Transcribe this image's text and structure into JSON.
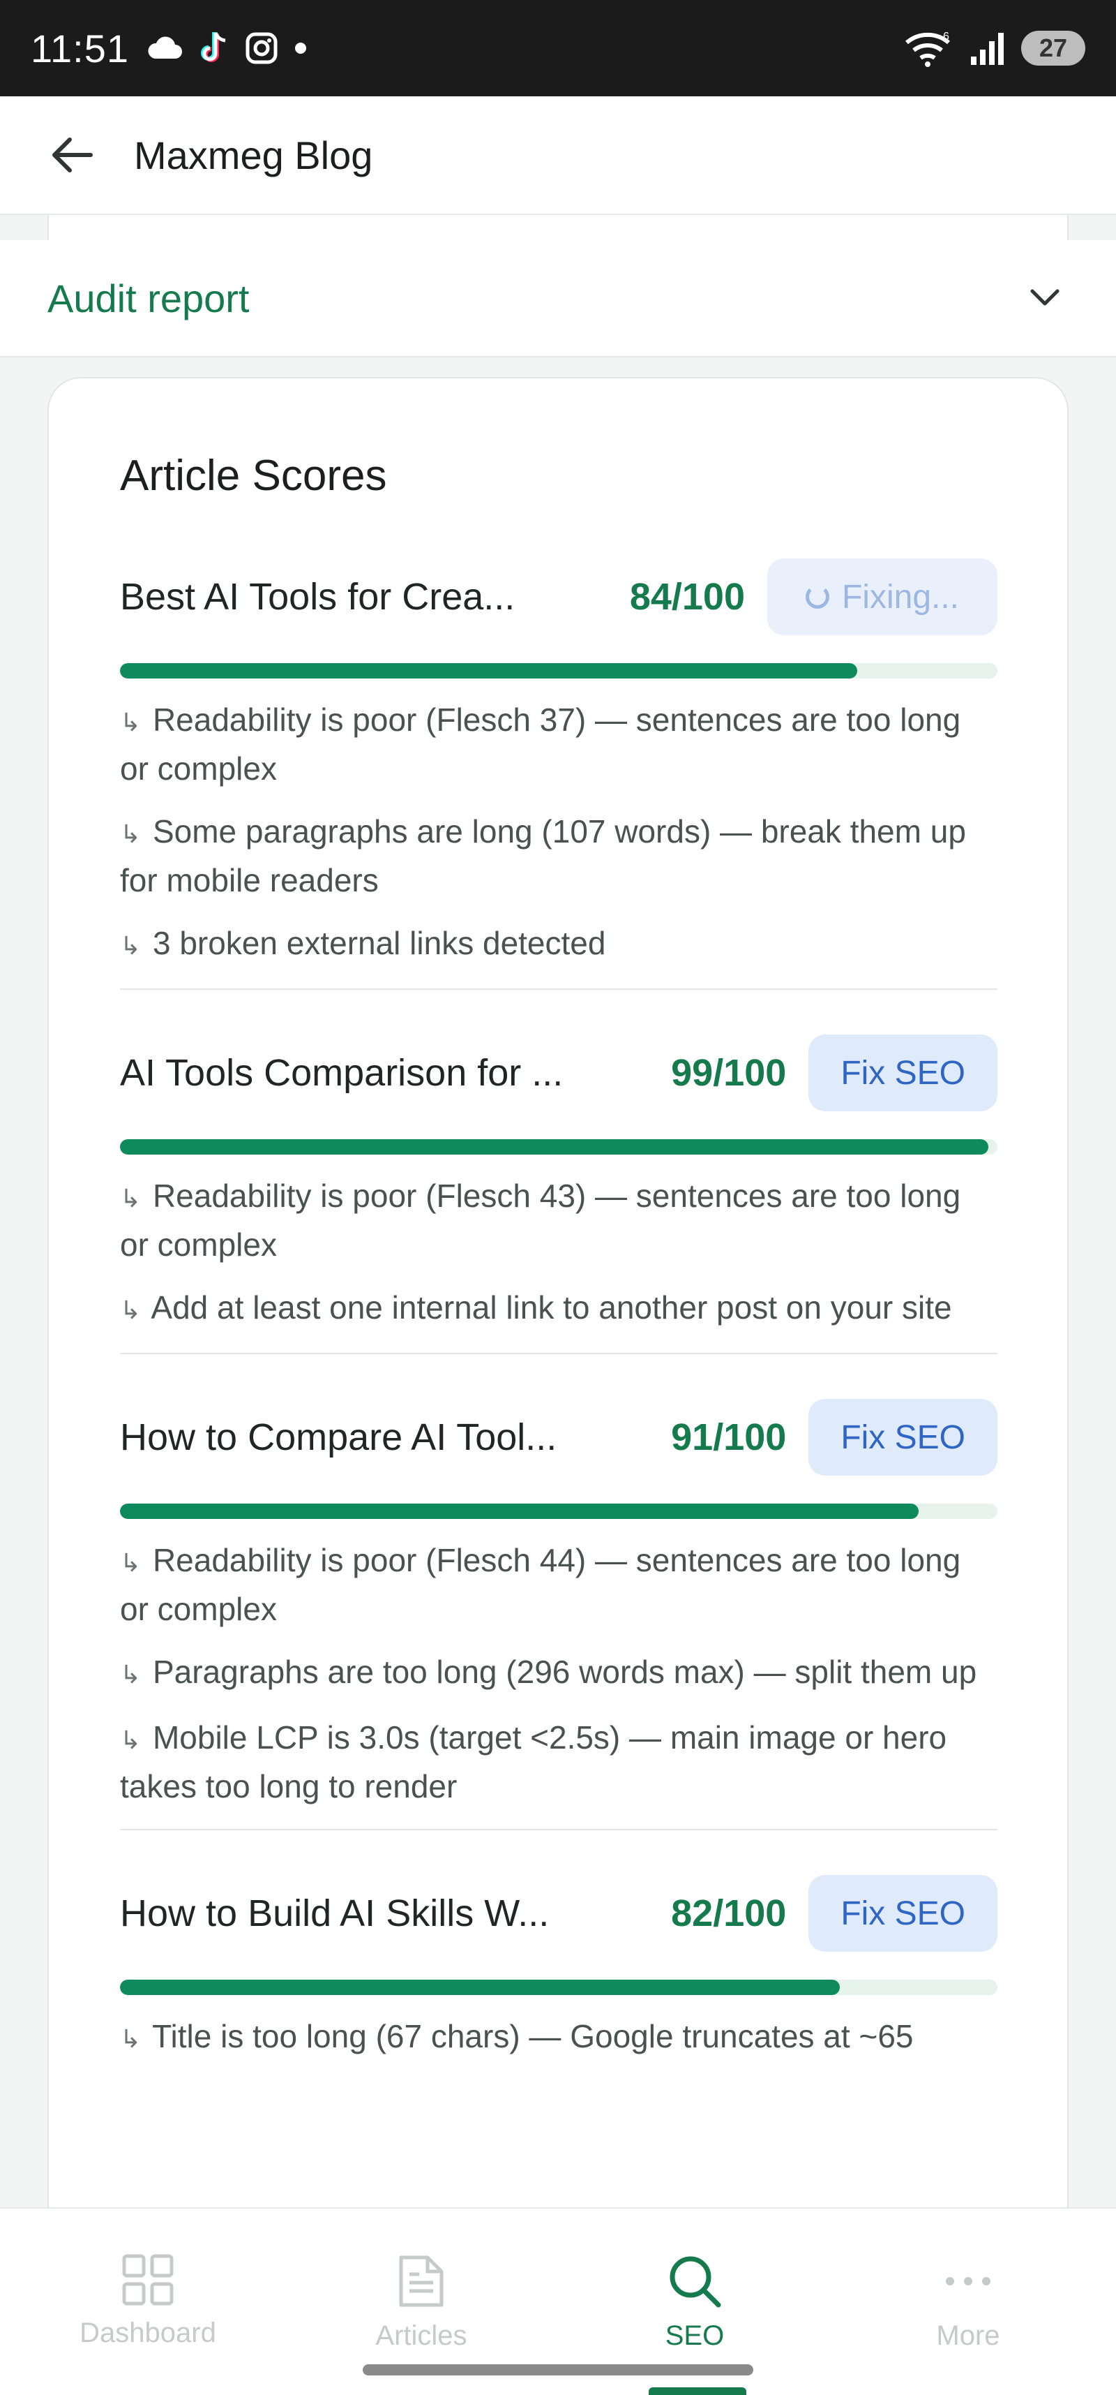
{
  "status_bar": {
    "time": "11:51",
    "battery": "27",
    "left_icons": [
      "cloud-icon",
      "tiktok-icon",
      "instagram-icon",
      "dot-icon"
    ],
    "right_icons": [
      "wifi-icon",
      "signal-icon",
      "battery-icon"
    ]
  },
  "header": {
    "title": "Maxmeg Blog"
  },
  "audit": {
    "title": "Audit report"
  },
  "scores": {
    "title": "Article Scores",
    "articles": [
      {
        "name": "Best AI Tools for Crea...",
        "score": "84/100",
        "score_fraction": 0.84,
        "button": "Fixing...",
        "issues": [
          "Readability is poor (Flesch 37) — sentences are too long or complex",
          "Some paragraphs are long (107 words) — break them up for mobile readers",
          "3 broken external links detected"
        ]
      },
      {
        "name": "AI Tools Comparison for ...",
        "score": "99/100",
        "score_fraction": 0.99,
        "button": "Fix SEO",
        "issues": [
          "Readability is poor (Flesch 43) — sentences are too long or complex",
          "Add at least one internal link to another post on your site"
        ]
      },
      {
        "name": "How to Compare AI Tool...",
        "score": "91/100",
        "score_fraction": 0.91,
        "button": "Fix SEO",
        "issues": [
          "Readability is poor (Flesch 44) — sentences are too long or complex",
          "Paragraphs are too long (296 words max) — split them up",
          "Mobile LCP is 3.0s (target <2.5s) — main image or hero takes too long to render"
        ]
      },
      {
        "name": "How to Build AI Skills W...",
        "score": "82/100",
        "score_fraction": 0.82,
        "button": "Fix SEO",
        "issues": [
          "Title is too long (67 chars) — Google truncates at ~65"
        ]
      }
    ]
  },
  "nav": {
    "items": [
      {
        "label": "Dashboard",
        "icon": "dashboard-icon"
      },
      {
        "label": "Articles",
        "icon": "articles-icon"
      },
      {
        "label": "SEO",
        "icon": "search-icon",
        "active": true
      },
      {
        "label": "More",
        "icon": "more-icon"
      }
    ]
  },
  "colors": {
    "accent": "#157a4c",
    "bar_fill": "#0f8a5c",
    "bar_track": "#e6f2ec",
    "button_bg": "#dfeafb",
    "button_text": "#2f66c5"
  }
}
